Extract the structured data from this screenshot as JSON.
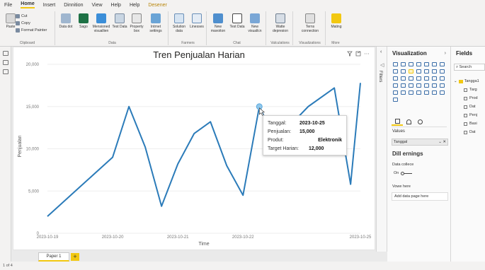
{
  "menubar": {
    "items": [
      "File",
      "Home",
      "Insert",
      "Dinnition",
      "View",
      "Help",
      "Help",
      "Desener"
    ]
  },
  "ribbon": {
    "paste": "Paste",
    "cut": "Cut",
    "copy": "Copy",
    "format_painter": "Format Painter",
    "clipboard_label": "Clipboard",
    "data_buttons": [
      "Data dot",
      "Sago",
      "Mensioned visuallien",
      "Test Data",
      "Property box",
      "Intrnet settings"
    ],
    "data_label": "Data",
    "farmers_buttons": [
      "Solution data",
      "Linesses"
    ],
    "farmers_label": "Farmers",
    "chat_buttons": [
      "New mavoiton",
      "Test Data",
      "New visuallcn"
    ],
    "chat_label": "Chat",
    "calc_buttons": [
      "Watte depresion"
    ],
    "calc_label": "Valculations",
    "viz_buttons": [
      "Terns connection"
    ],
    "viz_label": "Visualizations",
    "more_buttons": [
      "Mating"
    ],
    "more_label": "More"
  },
  "chart_data": {
    "type": "line",
    "title": "Tren Penjualan Harian",
    "xlabel": "Time",
    "ylabel": "Penjualan",
    "ylim": [
      0,
      20000
    ],
    "yticks": [
      "0",
      "5,000",
      "10,000",
      "15,000",
      "20,000"
    ],
    "xticks": [
      "2023-10-19",
      "2023-10-20",
      "2023-10-21",
      "2023-10-22",
      "2023-10-25"
    ],
    "x": [
      0,
      0.5,
      1.0,
      1.25,
      1.5,
      1.75,
      2.0,
      2.25,
      2.5,
      2.75,
      3.0,
      3.25,
      3.5,
      3.75,
      4.0,
      4.4,
      4.65,
      4.8
    ],
    "values": [
      2000,
      5500,
      9000,
      15000,
      10200,
      3200,
      8200,
      11800,
      13200,
      8000,
      4500,
      15000,
      11000,
      13000,
      15000,
      17200,
      5800,
      17800
    ],
    "series_color": "#2b7bb9",
    "highlight_index": 11,
    "tooltip": {
      "date_label": "Tanggal:",
      "date_value": "2023-10-25",
      "sales_label": "Penjualan:",
      "sales_value": "15,000",
      "product_label": "Produt:",
      "product_value": "Elektronik",
      "target_label": "Target Harian:",
      "target_value": "12,000"
    }
  },
  "filters_label": "Filters",
  "viz_pane": {
    "title": "Visualization",
    "values_label": "Values",
    "value_field": "Tanggal",
    "format_title": "Dill ernings",
    "data_collect": "Data collece",
    "toggle_label": "On",
    "vowe_label": "Vowe here",
    "add_data": "Add data page here"
  },
  "fields_pane": {
    "title": "Fields",
    "search_placeholder": "Search",
    "table": "Tangga1",
    "fields": [
      "Targ",
      "Prod",
      "Dat",
      "Penj",
      "Basi",
      "Dat"
    ]
  },
  "tabs": {
    "page": "Paper 1",
    "add": "+"
  },
  "status": {
    "page_count": "1 of 4"
  }
}
